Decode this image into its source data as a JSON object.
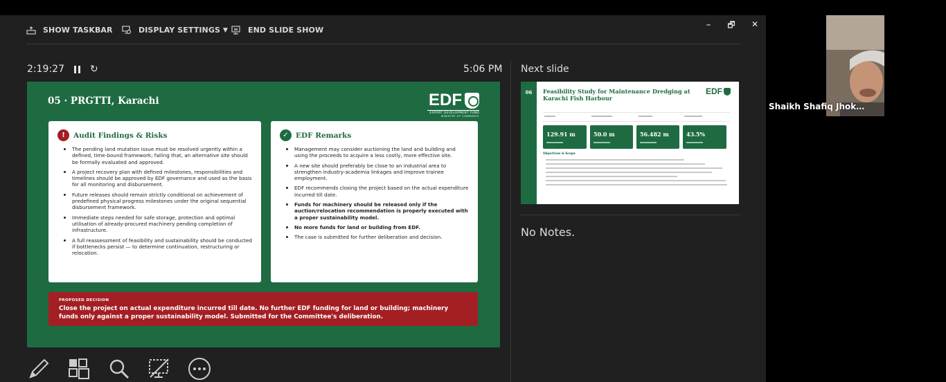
{
  "toolbar": {
    "show_taskbar": "SHOW TASKBAR",
    "display_settings": "DISPLAY SETTINGS",
    "end_slide_show": "END SLIDE SHOW"
  },
  "window": {
    "minimize": "–",
    "restore": "🗗",
    "close": "✕"
  },
  "timer": {
    "elapsed": "2:19:27",
    "clock": "5:06 PM"
  },
  "slide": {
    "title": "05 · PRGTTI, Karachi",
    "logo_text": "EDF",
    "logo_sub": "EXPORT DEVELOPMENT FUND",
    "logo_sub2": "MINISTRY OF COMMERCE",
    "audit": {
      "heading": "Audit Findings & Risks",
      "badge": "!",
      "items": [
        "The pending land mutation issue must be resolved urgently within a defined, time-bound framework; failing that, an alternative site should be formally evaluated and approved.",
        "A project recovery plan with defined milestones, responsibilities and timelines should be approved by EDF governance and used as the basis for all monitoring and disbursement.",
        "Future releases should remain strictly conditional on achievement of predefined physical progress milestones under the original sequential disbursement framework.",
        "Immediate steps needed for safe storage, protection and optimal utilisation of already-procured machinery pending completion of infrastructure.",
        "A full reassessment of feasibility and sustainability should be conducted if bottlenecks persist — to determine continuation, restructuring or relocation."
      ]
    },
    "remarks": {
      "heading": "EDF Remarks",
      "badge": "✓",
      "items": [
        "Management may consider auctioning the land and building and using the proceeds to acquire a less costly, more effective site.",
        "A new site should preferably be close to an industrial area to strengthen industry-academia linkages and improve trainee employment.",
        "EDF recommends closing the project based on the actual expenditure incurred till date.",
        "Funds for machinery should be released only if the auction/relocation recommendation is properly executed with a proper sustainability model.",
        "No more funds for land or building from EDF.",
        "The case is submitted for further deliberation and decision."
      ]
    },
    "decision": {
      "label": "PROPOSED DECISION",
      "text": "Close the project on actual expenditure incurred till date. No further EDF funding for land or building; machinery funds only against a proper sustainability model. Submitted for the Committee's deliberation."
    }
  },
  "next_slide": {
    "label": "Next slide",
    "number": "06",
    "title": "Feasibility Study for Maintenance Dredging at Karachi Fish Harbour",
    "logo_text": "EDF",
    "stats": [
      "129.91 m",
      "50.0 m",
      "56.482 m",
      "43.5%"
    ],
    "section": "Objectives & Scope"
  },
  "notes": {
    "text": "No Notes."
  },
  "participant": {
    "name": "Shaikh Shafiq Jhokw..."
  },
  "colors": {
    "slide_green": "#1e6b42",
    "decision_red": "#a41f24",
    "presenter_bg": "#202020"
  }
}
